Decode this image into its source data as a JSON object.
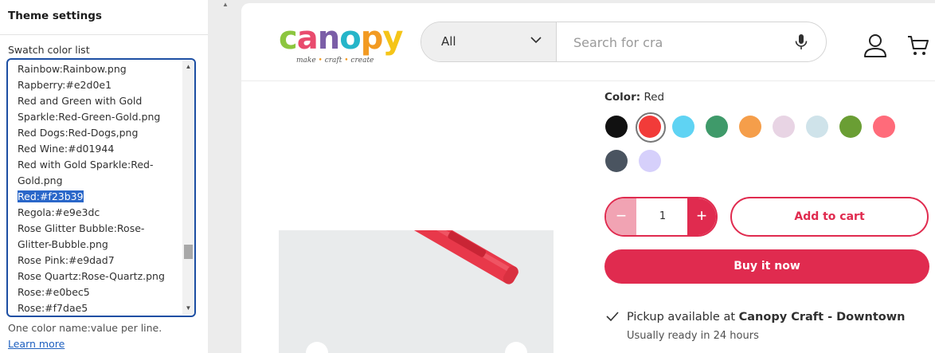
{
  "panel": {
    "title": "Theme settings",
    "field_label": "Swatch color list",
    "lines": [
      "Rainbow:Rainbow.png",
      "Rapberry:#e2d0e1",
      "Red and Green with Gold",
      "Sparkle:Red-Green-Gold.png",
      "Red Dogs:Red-Dogs,png",
      "Red Wine:#d01944",
      "Red with Gold Sparkle:Red-",
      "Gold.png",
      "Red:#f23b39",
      "Regola:#e9e3dc",
      "Rose Glitter Bubble:Rose-",
      "Glitter-Bubble.png",
      "Rose Pink:#e9dad7",
      "Rose Quartz:Rose-Quartz.png",
      "Rose:#e0bec5",
      "Rose:#f7dae5"
    ],
    "selected_line": "Red:#f23b39",
    "help_text": "One color name:value per line.",
    "learn_more": "Learn more"
  },
  "store": {
    "logo": {
      "letters": [
        {
          "char": "c",
          "color": "#8cc63f"
        },
        {
          "char": "a",
          "color": "#e94b6e"
        },
        {
          "char": "n",
          "color": "#7b5ea7"
        },
        {
          "char": "o",
          "color": "#26b5c9"
        },
        {
          "char": "p",
          "color": "#f29a22"
        },
        {
          "char": "y",
          "color": "#f5c518"
        }
      ],
      "tag_words": [
        "make",
        "craft",
        "create"
      ],
      "tag_separator": "•"
    },
    "search": {
      "category": "All",
      "placeholder": "Search for cra",
      "icons": [
        "chevron-down-icon",
        "microphone-icon"
      ]
    },
    "header_icons": [
      "account-icon",
      "cart-icon"
    ]
  },
  "product": {
    "color_label": "Color:",
    "color_value": "Red",
    "swatches": [
      {
        "color": "#111111",
        "selected": false
      },
      {
        "color": "#f23b39",
        "selected": true
      },
      {
        "color": "#5fd3f3",
        "selected": false
      },
      {
        "color": "#3f9a6a",
        "selected": false
      },
      {
        "color": "#f59e4a",
        "selected": false
      },
      {
        "color": "#e8d4e4",
        "selected": false
      },
      {
        "color": "#cfe3ea",
        "selected": false
      },
      {
        "color": "#6a9e34",
        "selected": false
      },
      {
        "color": "#ff6b7a",
        "selected": false
      },
      {
        "color": "#4a5460",
        "selected": false
      },
      {
        "color": "#d6d0fb",
        "selected": false
      }
    ],
    "quantity": "1",
    "qty_minus": "−",
    "qty_plus": "+",
    "add_to_cart": "Add to cart",
    "buy_now": "Buy it now",
    "pickup_prefix": "Pickup available at",
    "pickup_location": "Canopy Craft - Downtown",
    "ready_text": "Usually ready in 24 hours",
    "accent_color": "#e02b4f"
  }
}
